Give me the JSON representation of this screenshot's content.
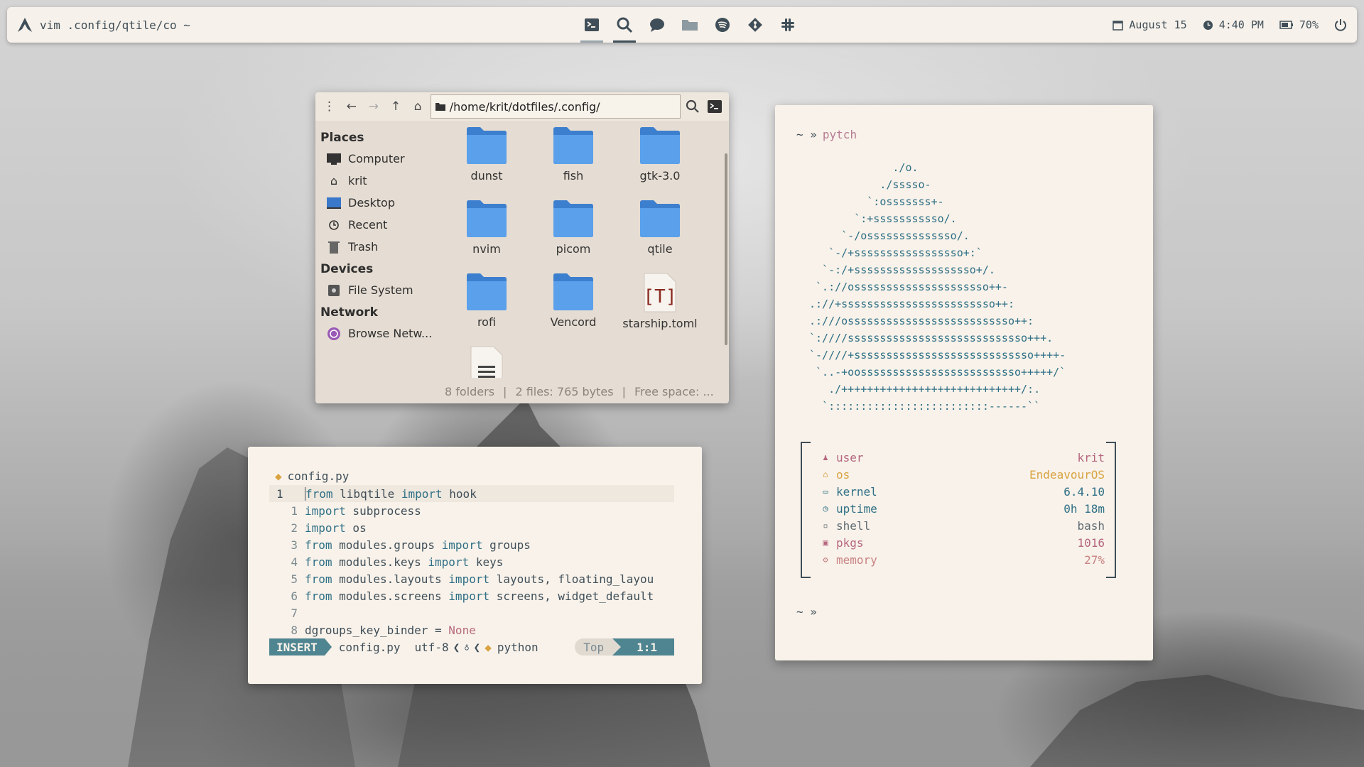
{
  "topbar": {
    "window_title": "vim .config/qtile/co ~",
    "workspace_icons": [
      "terminal-icon",
      "search-icon",
      "chat-icon",
      "folder-icon",
      "spotify-icon",
      "git-icon",
      "slack-icon"
    ],
    "date": "August 15",
    "time": "4:40 PM",
    "battery": "70%"
  },
  "file_manager": {
    "path": "/home/krit/dotfiles/.config/",
    "places_header": "Places",
    "devices_header": "Devices",
    "network_header": "Network",
    "places": [
      "Computer",
      "krit",
      "Desktop",
      "Recent",
      "Trash"
    ],
    "devices": [
      "File System"
    ],
    "network": [
      "Browse Netw..."
    ],
    "items": [
      {
        "name": "dunst",
        "type": "folder"
      },
      {
        "name": "fish",
        "type": "folder"
      },
      {
        "name": "gtk-3.0",
        "type": "folder"
      },
      {
        "name": "nvim",
        "type": "folder"
      },
      {
        "name": "picom",
        "type": "folder"
      },
      {
        "name": "qtile",
        "type": "folder"
      },
      {
        "name": "rofi",
        "type": "folder"
      },
      {
        "name": "Vencord",
        "type": "folder"
      },
      {
        "name": "starship.toml",
        "type": "text-file"
      },
      {
        "name": "",
        "type": "doc-file"
      }
    ],
    "status": {
      "folders": "8 folders",
      "files": "2 files: 765 bytes",
      "free": "Free space: ..."
    }
  },
  "vim": {
    "filename": "config.py",
    "lines": [
      {
        "num": "1",
        "tokens": [
          [
            "kw",
            "from"
          ],
          [
            "t",
            " libqtile "
          ],
          [
            "kw",
            "import"
          ],
          [
            "t",
            " hook"
          ]
        ]
      },
      {
        "num": "1",
        "tokens": [
          [
            "kw",
            "import"
          ],
          [
            "t",
            " subprocess"
          ]
        ]
      },
      {
        "num": "2",
        "tokens": [
          [
            "kw",
            "import"
          ],
          [
            "t",
            " os"
          ]
        ]
      },
      {
        "num": "3",
        "tokens": [
          [
            "kw",
            "from"
          ],
          [
            "t",
            " modules.groups "
          ],
          [
            "kw",
            "import"
          ],
          [
            "t",
            " groups"
          ]
        ]
      },
      {
        "num": "4",
        "tokens": [
          [
            "kw",
            "from"
          ],
          [
            "t",
            " modules.keys "
          ],
          [
            "kw",
            "import"
          ],
          [
            "t",
            " keys"
          ]
        ]
      },
      {
        "num": "5",
        "tokens": [
          [
            "kw",
            "from"
          ],
          [
            "t",
            " modules.layouts "
          ],
          [
            "kw",
            "import"
          ],
          [
            "t",
            " layouts, floating_layou"
          ]
        ]
      },
      {
        "num": "6",
        "tokens": [
          [
            "kw",
            "from"
          ],
          [
            "t",
            " modules.screens "
          ],
          [
            "kw",
            "import"
          ],
          [
            "t",
            " screens, widget_default"
          ]
        ]
      },
      {
        "num": "7",
        "tokens": []
      },
      {
        "num": "8",
        "tokens": [
          [
            "t",
            "dgroups_key_binder = "
          ],
          [
            "nn",
            "None"
          ]
        ]
      }
    ],
    "status": {
      "mode": "INSERT",
      "file": "config.py",
      "encoding": "utf-8",
      "filetype": "python",
      "scroll": "Top",
      "position": "1:1"
    }
  },
  "terminal": {
    "prompt": "~ »",
    "command": "pytch",
    "ascii_art": "             ./o.\n           ./sssso-\n         `:osssssss+-\n       `:+sssssssssso/.\n     `-/ossssssssssssso/.\n   `-/+sssssssssssssssso+:`\n  `-:/+sssssssssssssssssso+/.\n `.://osssssssssssssssssssso++-\n.://+ssssssssssssssssssssssso++:\n.:///ossssssssssssssssssssssssso++:\n`:////ssssssssssssssssssssssssssso+++.\n`-////+ssssssssssssssssssssssssssso++++-\n `..-+oosssssssssssssssssssssssso+++++/`\n   ./++++++++++++++++++++++++++++/:.\n  `:::::::::::::::::::::::::------``",
    "info": [
      {
        "icon": "user-icon",
        "key": "user",
        "value": "krit",
        "color": "#b5667f"
      },
      {
        "icon": "os-icon",
        "key": "os",
        "value": "EndeavourOS",
        "color": "#d9a341"
      },
      {
        "icon": "kernel-icon",
        "key": "kernel",
        "value": "6.4.10",
        "color": "#2f6f85"
      },
      {
        "icon": "uptime-icon",
        "key": "uptime",
        "value": "0h 18m",
        "color": "#2f6f85"
      },
      {
        "icon": "shell-icon",
        "key": "shell",
        "value": "bash",
        "color": "#5f6b72"
      },
      {
        "icon": "pkgs-icon",
        "key": "pkgs",
        "value": "1016",
        "color": "#b5667f"
      },
      {
        "icon": "memory-icon",
        "key": "memory",
        "value": "27%",
        "color": "#c98282"
      }
    ],
    "prompt2": "~ »"
  },
  "colors": {
    "accent": "#4f8591",
    "bar_bg": "#f6f1ea",
    "fm_bg": "#e5ddd3",
    "folder": "#4a8fde"
  }
}
